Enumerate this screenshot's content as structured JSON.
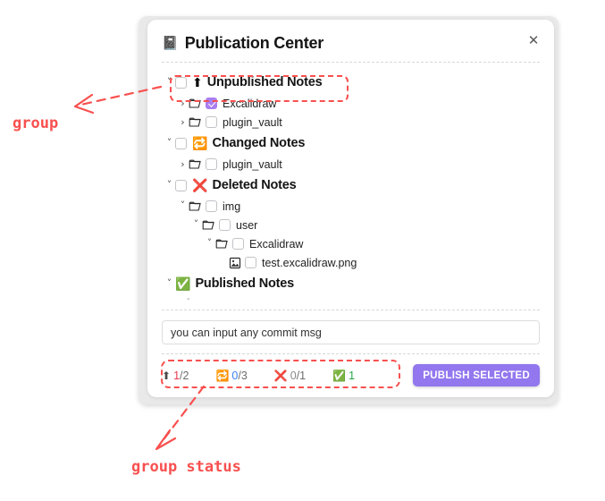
{
  "dialog": {
    "header": {
      "icon": "notebook-icon",
      "icon_glyph": "📓",
      "title": "Publication Center"
    },
    "close_label": "✕"
  },
  "tree": {
    "groups": [
      {
        "name": "unpublished-notes",
        "chevron": "˅",
        "emoji": "⬆",
        "label": "Unpublished Notes",
        "checked": false,
        "highlighted": true,
        "children": [
          {
            "name": "excalidraw",
            "type": "folder",
            "chevron": "›",
            "label": "Excalidraw",
            "checked": true,
            "level": 1
          },
          {
            "name": "plugin-vault",
            "type": "folder",
            "chevron": "›",
            "label": "plugin_vault",
            "checked": false,
            "level": 1
          }
        ]
      },
      {
        "name": "changed-notes",
        "chevron": "˅",
        "emoji": "🔁",
        "label": "Changed Notes",
        "checked": false,
        "highlighted": false,
        "children": [
          {
            "name": "plugin-vault",
            "type": "folder",
            "chevron": "›",
            "label": "plugin_vault",
            "checked": false,
            "level": 1
          }
        ]
      },
      {
        "name": "deleted-notes",
        "chevron": "˅",
        "emoji": "❌",
        "label": "Deleted Notes",
        "checked": false,
        "highlighted": false,
        "children": [
          {
            "name": "img",
            "type": "folder",
            "chevron": "˅",
            "label": "img",
            "checked": false,
            "level": 1
          },
          {
            "name": "user",
            "type": "folder",
            "chevron": "˅",
            "label": "user",
            "checked": false,
            "level": 2
          },
          {
            "name": "excalidraw",
            "type": "folder",
            "chevron": "˅",
            "label": "Excalidraw",
            "checked": false,
            "level": 3
          },
          {
            "name": "test-excalidraw-png",
            "type": "file",
            "chevron": "",
            "label": "test.excalidraw.png",
            "checked": false,
            "level": 4
          }
        ]
      },
      {
        "name": "published-notes",
        "chevron": "˅",
        "emoji": "✅",
        "label": "Published Notes",
        "checked": null,
        "highlighted": false,
        "stub": "-",
        "children": []
      }
    ]
  },
  "commit": {
    "value": "you can input any commit msg",
    "placeholder": "you can input any commit msg"
  },
  "footer": {
    "stats": [
      {
        "name": "unpublished",
        "icon": "⬆",
        "current": "1",
        "total": "2",
        "current_color": "red"
      },
      {
        "name": "changed",
        "icon": "🔁",
        "current": "0",
        "total": "3",
        "current_color": "blue"
      },
      {
        "name": "deleted",
        "icon": "❌",
        "current": "0",
        "total": "1",
        "current_color": "grey"
      },
      {
        "name": "published",
        "icon": "✅",
        "current": "1",
        "total": "",
        "current_color": "green"
      }
    ],
    "publish_label": "PUBLISH SELECTED"
  },
  "annotations": {
    "group": "group",
    "group_status": "group status",
    "color": "#f8504f"
  },
  "colors": {
    "accent_purple": "#9277ee",
    "checkbox_purple": "#a97ef0",
    "annotation_red": "#f8504f"
  }
}
